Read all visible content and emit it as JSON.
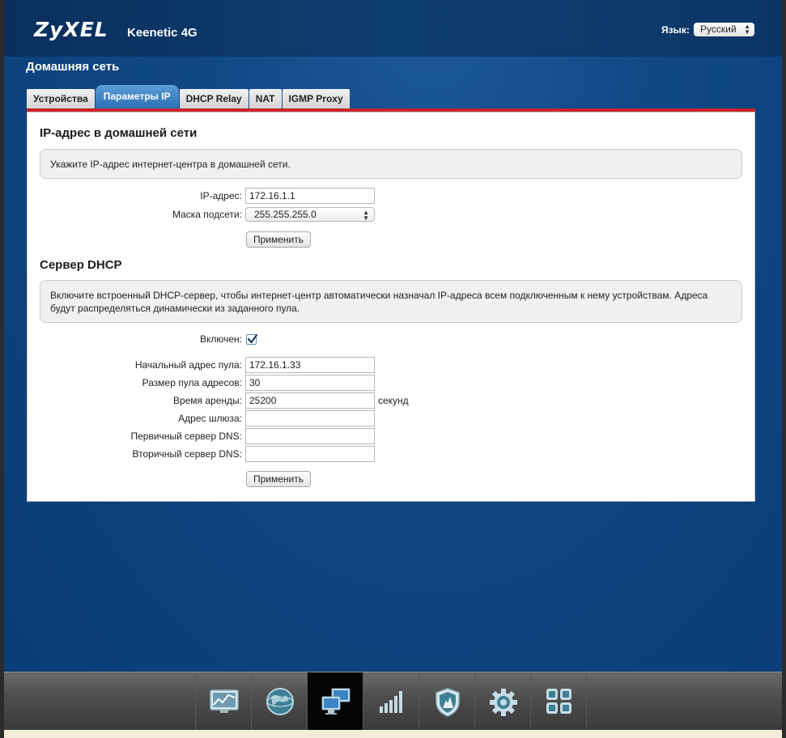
{
  "header": {
    "logo": "ZyXEL",
    "model": "Keenetic 4G",
    "language_label": "Язык:",
    "language_value": "Русский"
  },
  "page_title": "Домашняя сеть",
  "tabs": [
    {
      "label": "Устройства",
      "active": false
    },
    {
      "label": "Параметры IP",
      "active": true
    },
    {
      "label": "DHCP Relay",
      "active": false
    },
    {
      "label": "NAT",
      "active": false
    },
    {
      "label": "IGMP Proxy",
      "active": false
    }
  ],
  "ip_section": {
    "title": "IP-адрес в домашней сети",
    "info": "Укажите IP-адрес интернет-центра в домашней сети.",
    "ip_label": "IP-адрес:",
    "ip_value": "172.16.1.1",
    "mask_label": "Маска подсети:",
    "mask_value": "255.255.255.0",
    "apply_label": "Применить"
  },
  "dhcp_section": {
    "title": "Сервер DHCP",
    "info": "Включите встроенный DHCP-сервер, чтобы интернет-центр автоматически назначал IP-адреса всем подключенным к нему устройствам. Адреса будут распределяться динамически из заданного пула.",
    "enabled_label": "Включен:",
    "enabled": true,
    "pool_start_label": "Начальный адрес пула:",
    "pool_start_value": "172.16.1.33",
    "pool_size_label": "Размер пула адресов:",
    "pool_size_value": "30",
    "lease_label": "Время аренды:",
    "lease_value": "25200",
    "lease_unit": "секунд",
    "gateway_label": "Адрес шлюза:",
    "gateway_value": "",
    "dns1_label": "Первичный сервер DNS:",
    "dns1_value": "",
    "dns2_label": "Вторичный сервер DNS:",
    "dns2_value": "",
    "apply_label": "Применить"
  },
  "dock": {
    "items": [
      {
        "icon": "monitor-chart-icon",
        "active": false
      },
      {
        "icon": "globe-icon",
        "active": false
      },
      {
        "icon": "home-network-icon",
        "active": true
      },
      {
        "icon": "signal-bars-icon",
        "active": false
      },
      {
        "icon": "shield-icon",
        "active": false
      },
      {
        "icon": "gear-icon",
        "active": false
      },
      {
        "icon": "apps-grid-icon",
        "active": false
      }
    ]
  },
  "colors": {
    "background": "#0f4784",
    "accent_red": "#c8242b",
    "active_tab": "#2a6fb5"
  }
}
